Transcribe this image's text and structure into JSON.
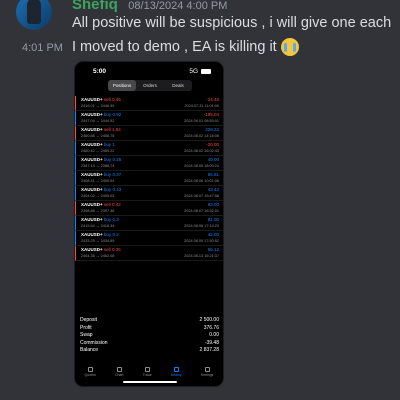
{
  "chat": {
    "username": "Shefiq",
    "header_timestamp": "08/13/2024 4:00 PM",
    "message1": "All positive will be suspicious , i will give one each",
    "message2_time": "4:01 PM",
    "message2": "I moved to demo , EA is killing it",
    "emoji": "loudly-crying-face"
  },
  "phone": {
    "time": "5:00",
    "signal_label": "5G",
    "tabs": [
      "Positions",
      "Orders",
      "Deals"
    ],
    "active_tab": "Positions",
    "positions": [
      {
        "symbol": "XAUUSD+",
        "side": "sell",
        "volume": "0.46",
        "prices": "2416.01 → 2446.99",
        "pnl": "-24.48",
        "datetime": "2024.07.31 11:01:00"
      },
      {
        "symbol": "XAUUSD+",
        "side": "buy",
        "volume": "0.92",
        "prices": "2447.04 → 2444.92",
        "pnl": "-195.04",
        "datetime": "2024.09.01 08:50:01"
      },
      {
        "symbol": "XAUUSD+",
        "side": "sell",
        "volume": "1.84",
        "prices": "2460.88 → 2458.75",
        "pnl": "226.32",
        "datetime": "2024.08.02 14:16:06"
      },
      {
        "symbol": "XAUUSD+",
        "side": "buy",
        "volume": "1",
        "prices": "2460.42 → 2459.22",
        "pnl": "-20.00",
        "datetime": "2024.08.02 16:02:43"
      },
      {
        "symbol": "XAUUSD+",
        "side": "buy",
        "volume": "0.25",
        "prices": "2387.14 → 2388.74",
        "pnl": "40.00",
        "datetime": "2024.08.05 18:00:24"
      },
      {
        "symbol": "XAUUSD+",
        "side": "buy",
        "volume": "0.37",
        "prices": "2408.41 → 2409.94",
        "pnl": "56.61",
        "datetime": "2024.08.06 10:01:06"
      },
      {
        "symbol": "XAUUSD+",
        "side": "buy",
        "volume": "0.43",
        "prices": "2404.02 → 2405.03",
        "pnl": "43.43",
        "datetime": "2024.08.07 15:47:58"
      },
      {
        "symbol": "XAUUSD+",
        "side": "sell",
        "volume": "0.42",
        "prices": "2398.86 → 2397.36",
        "pnl": "63.00",
        "datetime": "2024.08.07 16:52:01"
      },
      {
        "symbol": "XAUUSD+",
        "side": "buy",
        "volume": "0.3",
        "prices": "2415.64 → 2418.34",
        "pnl": "81.00",
        "datetime": "2024.08.08 17:10:23"
      },
      {
        "symbol": "XAUUSD+",
        "side": "buy",
        "volume": "0.2",
        "prices": "2433.25 → 2434.89",
        "pnl": "42.00",
        "datetime": "2024.08.09 17:50:52"
      },
      {
        "symbol": "XAUUSD+",
        "side": "sell",
        "volume": "0.25",
        "prices": "2464.38 → 2462.08",
        "pnl": "66.12",
        "datetime": "2024.08.13 16:21:37"
      }
    ],
    "summary": [
      {
        "label": "Deposit",
        "value": "2 500.00"
      },
      {
        "label": "Profit",
        "value": "376.76"
      },
      {
        "label": "Swap",
        "value": "0.00"
      },
      {
        "label": "Commission",
        "value": "-39.48"
      },
      {
        "label": "Balance",
        "value": "2 837.28"
      }
    ],
    "bottom_nav": [
      {
        "label": "Quotes",
        "icon": "quotes-icon"
      },
      {
        "label": "Chart",
        "icon": "chart-icon"
      },
      {
        "label": "Trade",
        "icon": "trade-icon"
      },
      {
        "label": "History",
        "icon": "history-icon",
        "active": true
      },
      {
        "label": "Settings",
        "icon": "settings-icon"
      }
    ],
    "colors": {
      "sell": "#ff453a",
      "buy": "#0a84ff",
      "positive": "#0a84ff",
      "negative": "#ff453a"
    }
  }
}
